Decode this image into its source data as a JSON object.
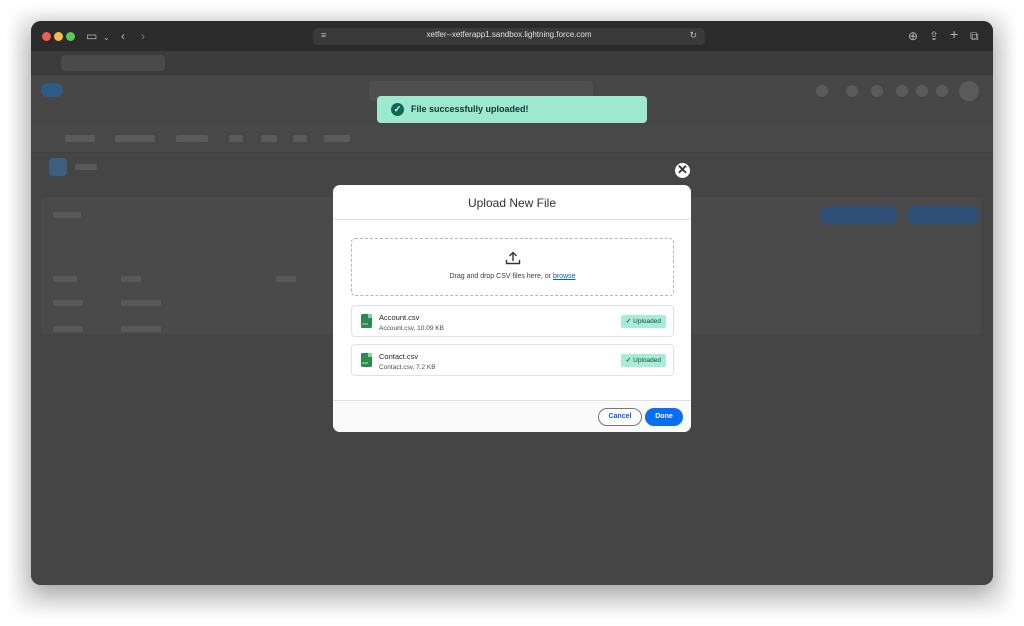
{
  "browser": {
    "url": "xetfer--xetferapp1.sandbox.lightning.force.com"
  },
  "toast": {
    "message": "File successfully uploaded!"
  },
  "modal": {
    "title": "Upload New File",
    "dropzone": {
      "text": "Drag and drop CSV files here, or ",
      "link": "browse"
    },
    "files": [
      {
        "name": "Account.csv",
        "meta": "Account.csv, 10.09 KB",
        "status": "Uploaded"
      },
      {
        "name": "Contact.csv",
        "meta": "Contact.csv, 7.2 KB",
        "status": "Uploaded"
      }
    ],
    "footer": {
      "cancel_label": "Cancel",
      "done_label": "Done"
    }
  },
  "icons": {
    "check": "✓",
    "close": "✕",
    "file_type": "CSV"
  },
  "colors": {
    "toast_bg": "#9fe8d0",
    "primary": "#0b6ef0",
    "link": "#0b5cd5",
    "badge_bg": "#a8ecd6",
    "file_icon": "#2d8a4e"
  }
}
